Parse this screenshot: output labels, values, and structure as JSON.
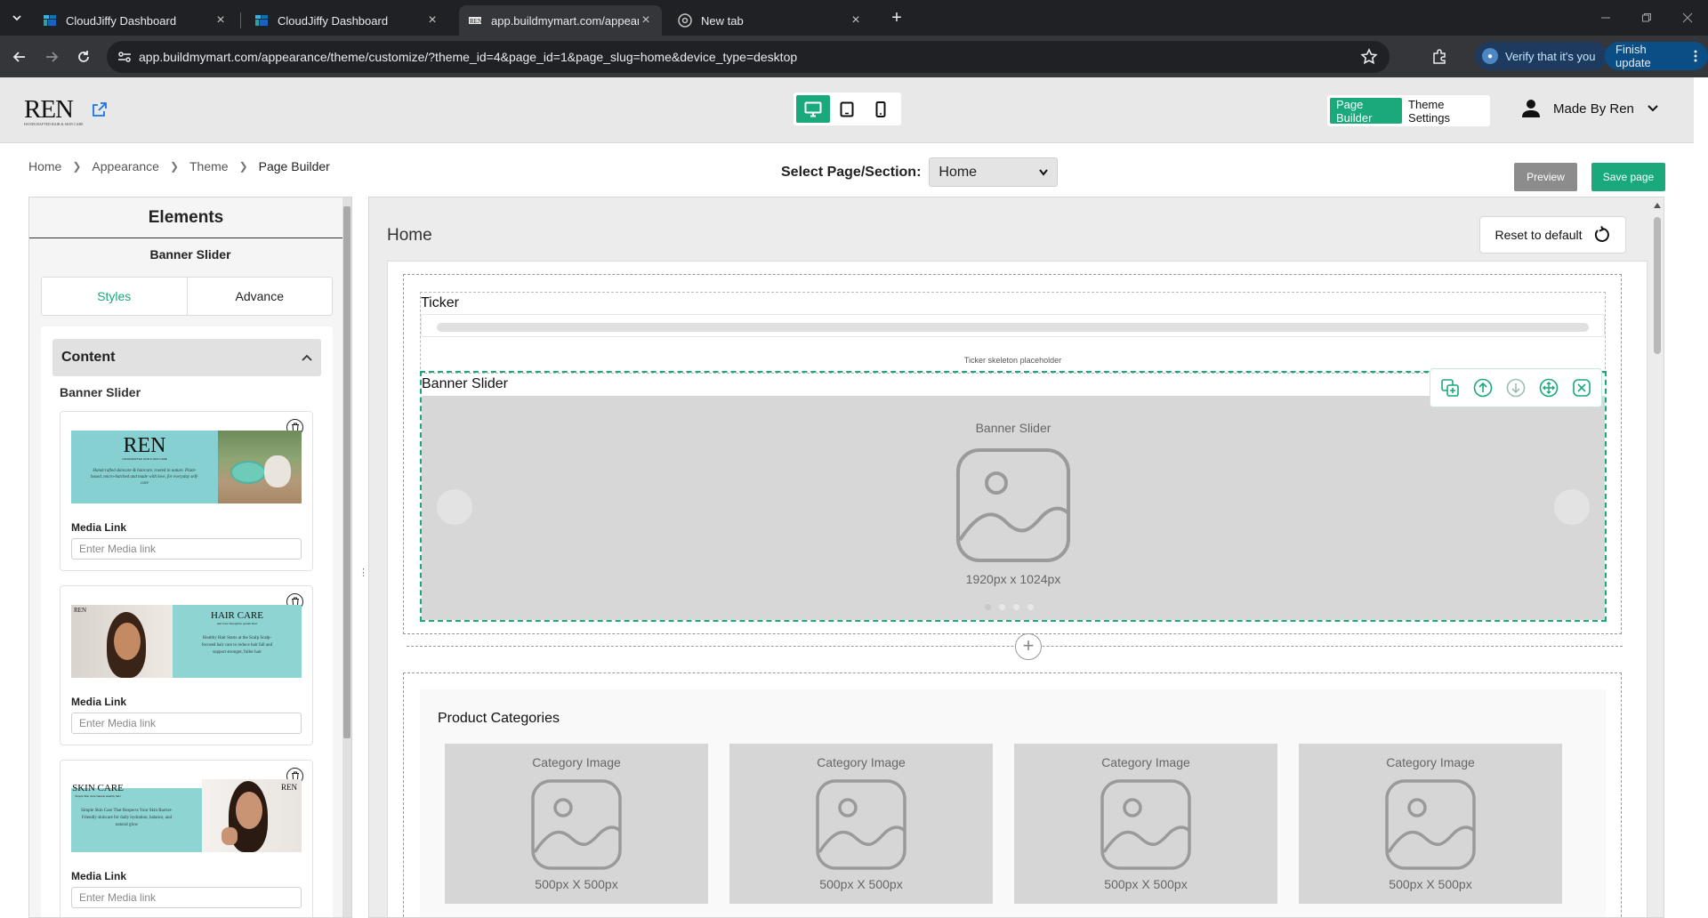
{
  "browser": {
    "tabs": [
      {
        "title": "CloudJiffy Dashboard",
        "close": "×"
      },
      {
        "title": "CloudJiffy Dashboard",
        "close": "×"
      },
      {
        "title": "app.buildmymart.com/appeara",
        "close": "×"
      },
      {
        "title": "New tab",
        "close": "×"
      }
    ],
    "new_tab": "+",
    "url": "app.buildmymart.com/appearance/theme/customize/?theme_id=4&page_id=1&page_slug=home&device_type=desktop",
    "verify_label": "Verify that it's you",
    "finish_update_label": "Finish update"
  },
  "header": {
    "logo": "REN",
    "logo_tagline": "HANDCRAFTED HAIR & SKIN CARE",
    "mode_page_builder": "Page Builder",
    "mode_theme_settings": "Theme Settings",
    "user_name": "Made By Ren"
  },
  "breadcrumb": [
    "Home",
    "Appearance",
    "Theme",
    "Page Builder"
  ],
  "page_select": {
    "label": "Select Page/Section:",
    "value": "Home"
  },
  "actions": {
    "preview": "Preview",
    "save": "Save page"
  },
  "elements_panel": {
    "title": "Elements",
    "subtitle": "Banner Slider",
    "tabs": [
      "Styles",
      "Advance"
    ],
    "content_heading": "Content",
    "section_label": "Banner Slider",
    "slides": [
      {
        "brand": "REN",
        "tagline": "HANDCRAFTED HAIR & SKIN CARE",
        "text": "Handcrafted skincare & haircare, rooted in nature. Plant-based, micro-batched and made with love, for everyday self-care",
        "link_label": "Media Link",
        "link_placeholder": "Enter Media link"
      },
      {
        "brand": "REN",
        "heading": "HAIR CARE",
        "tagline": "Hair Care Strengthen growth Root",
        "text": "Healthy Hair Starts at the Scalp Scalp-focused hair care to reduce hair fall and support stronger, fuller hair",
        "link_label": "Media Link",
        "link_placeholder": "Enter Media link"
      },
      {
        "brand": "REN",
        "heading": "SKIN CARE",
        "tagline": "Simple Skin Care Natural Healthy Skin",
        "text": "Simple Skin Care That Respects Your Skin Barrier-Friendly skincare for daily hydration, balance, and natural glow",
        "link_label": "Media Link",
        "link_placeholder": "Enter Media link"
      }
    ]
  },
  "canvas": {
    "title": "Home",
    "reset_label": "Reset to default",
    "ticker": {
      "title": "Ticker",
      "placeholder": "Ticker skeleton placeholder"
    },
    "banner": {
      "title": "Banner Slider",
      "label": "Banner Slider",
      "size": "1920px x 1024px",
      "dots": 4,
      "active_dot": 0
    },
    "product_categories": {
      "title": "Product Categories",
      "items": [
        {
          "label": "Category Image",
          "size": "500px X 500px"
        },
        {
          "label": "Category Image",
          "size": "500px X 500px"
        },
        {
          "label": "Category Image",
          "size": "500px X 500px"
        },
        {
          "label": "Category Image",
          "size": "500px X 500px"
        }
      ]
    }
  },
  "colors": {
    "accent": "#19a97b",
    "chrome_dark": "#202124",
    "chrome_toolbar": "#35363a",
    "header_bg": "#e8e8e8",
    "placeholder_gray": "#d6d6d6"
  }
}
